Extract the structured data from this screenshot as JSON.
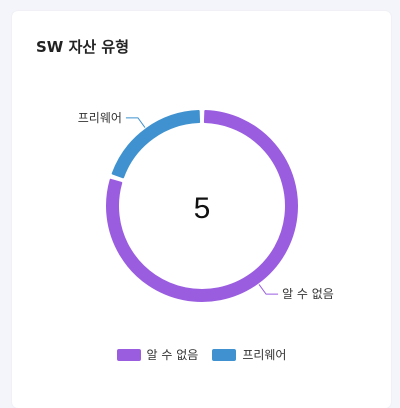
{
  "card": {
    "title": "SW 자산 유형"
  },
  "chart_data": {
    "type": "pie",
    "total_label": "5",
    "series": [
      {
        "name": "알 수 없음",
        "value": 4,
        "color": "#9a5de0"
      },
      {
        "name": "프리웨어",
        "value": 1,
        "color": "#3f92cf"
      }
    ]
  }
}
